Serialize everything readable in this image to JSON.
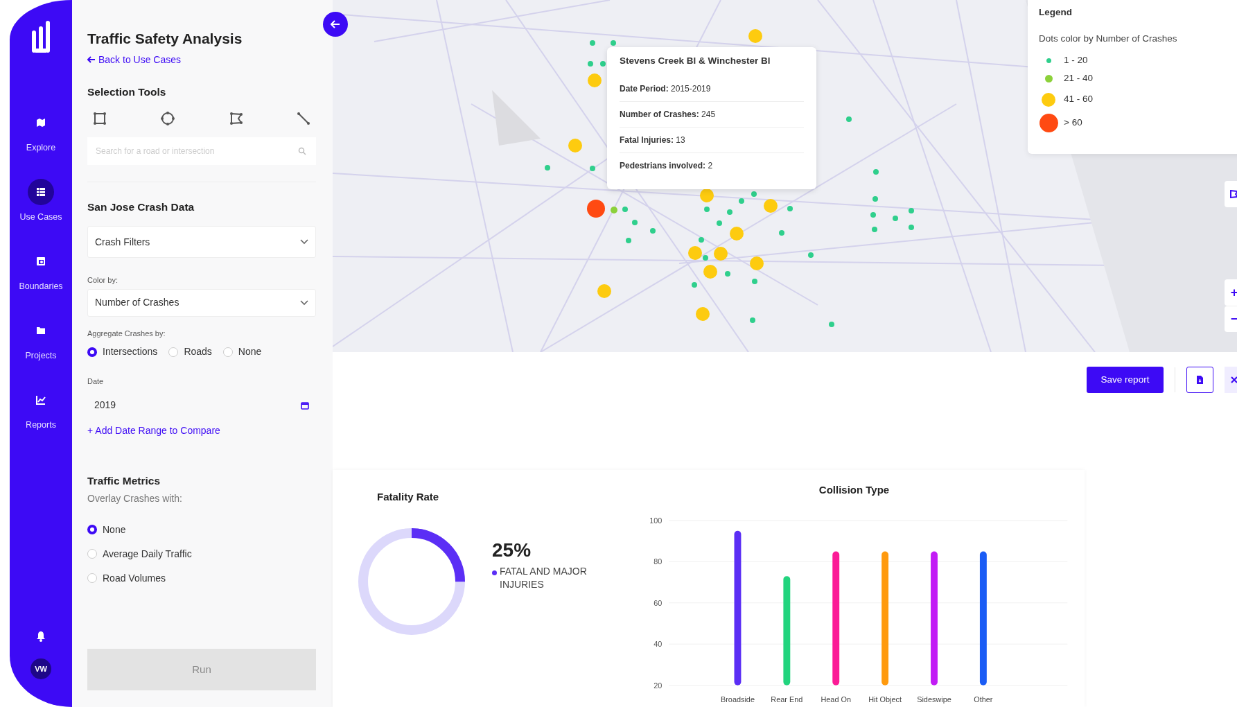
{
  "nav": {
    "items": [
      {
        "label": "Explore",
        "selected": false
      },
      {
        "label": "Use Cases",
        "selected": true
      },
      {
        "label": "Boundaries",
        "selected": false
      },
      {
        "label": "Projects",
        "selected": false
      },
      {
        "label": "Reports",
        "selected": false
      }
    ],
    "avatar": "VW"
  },
  "panel": {
    "title": "Traffic Safety Analysis",
    "back_link": "Back to Use Cases",
    "selection_tools": {
      "heading": "Selection Tools",
      "search": {
        "placeholder": "Search for a road or intersection"
      }
    },
    "crash_data": {
      "heading": "San Jose Crash Data",
      "filters": "Crash Filters",
      "color_by_label": "Color by:",
      "color_by_value": "Number of Crashes",
      "aggregate_label": "Aggregate Crashes by:",
      "aggregate_options": [
        {
          "label": "Intersections",
          "selected": true
        },
        {
          "label": "Roads",
          "selected": false
        },
        {
          "label": "None",
          "selected": false
        }
      ],
      "date_label": "Date",
      "date_value": "2019",
      "add_range": "+ Add Date Range to Compare"
    },
    "metrics": {
      "heading": "Traffic Metrics",
      "subheading": "Overlay Crashes with:",
      "options": [
        {
          "label": "None",
          "selected": true
        },
        {
          "label": "Average Daily Traffic",
          "selected": false
        },
        {
          "label": "Road Volumes",
          "selected": false
        }
      ]
    },
    "run_button": {
      "label": "Run",
      "disabled": true
    }
  },
  "map": {
    "tooltip": {
      "title": "Stevens Creek Bl & Winchester Bl",
      "rows": [
        {
          "label": "Date Period:",
          "value": "2015-2019"
        },
        {
          "label": "Number of Crashes:",
          "value": "245"
        },
        {
          "label": "Fatal Injuries:",
          "value": "13"
        },
        {
          "label": "Pedestrians involved:",
          "value": "2"
        }
      ]
    },
    "legend": {
      "title": "Legend",
      "subtitle": "Dots color by Number of Crashes",
      "items": [
        {
          "label": "1 - 20",
          "color": "#2fcf8c"
        },
        {
          "label": "21 - 40",
          "color": "#8cd13a"
        },
        {
          "label": "41 - 60",
          "color": "#fdcb0f"
        },
        {
          "label": "> 60",
          "color": "#ff4a12"
        }
      ]
    },
    "zoom_controls": {
      "zoom_in": "+",
      "zoom_out": "−"
    }
  },
  "report_toolbar": {
    "save_button": "Save report"
  },
  "fatality": {
    "title": "Fatality Rate",
    "level": 0.25,
    "reading": "25%",
    "legend": "FATAL AND MAJOR INJURIES"
  },
  "collision": {
    "chart_data": {
      "type": "bar",
      "title": "Collision Type",
      "categories": [
        "Broadside",
        "Rear End",
        "Head On",
        "Hit Object",
        "Sideswipe",
        "Other"
      ],
      "series": [
        {
          "values": [
            95,
            73,
            85,
            85,
            85,
            85
          ]
        }
      ],
      "grid": true,
      "colors": [
        "#5b2ef5",
        "#22d47e",
        "#fb1b96",
        "#ff9a0e",
        "#c21cf5",
        "#1a5cf5"
      ],
      "ylim": [
        20,
        100
      ],
      "yticks": [
        20,
        40,
        60,
        80,
        100
      ]
    }
  }
}
